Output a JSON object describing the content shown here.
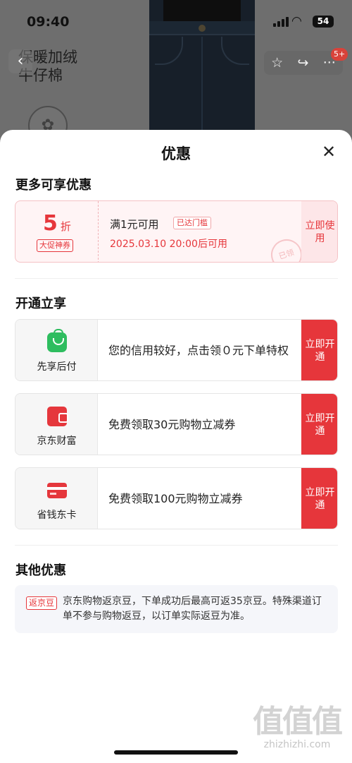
{
  "status_bar": {
    "time": "09:40",
    "battery": "54"
  },
  "background": {
    "promo_tag": "保暖加绒牛仔棉",
    "cart_count": "5+"
  },
  "sheet": {
    "title": "优惠",
    "more_title": "更多可享优惠",
    "coupon": {
      "discount_num": "5",
      "discount_unit": "折",
      "tag": "大促神券",
      "condition": "满1元可用",
      "reached": "已达门槛",
      "time": "2025.03.10 20:00后可用",
      "stamp": "已领",
      "use_button": "立即使用"
    },
    "open_title": "开通立享",
    "services": [
      {
        "icon": "shopping-bag-icon",
        "label": "先享后付",
        "desc": "您的信用较好，点击领０元下单特权",
        "button": "立即开通"
      },
      {
        "icon": "wallet-icon",
        "label": "京东财富",
        "desc": "免费领取30元购物立减券",
        "button": "立即开通"
      },
      {
        "icon": "card-icon",
        "label": "省钱东卡",
        "desc": "免费领取100元购物立减券",
        "button": "立即开通"
      }
    ],
    "other_title": "其他优惠",
    "bean": {
      "tag": "返京豆",
      "text": "京东购物返京豆，下单成功后最高可返35京豆。特殊渠道订单不参与购物返豆，以订单实际返豆为准。"
    }
  },
  "watermark": {
    "big": "值值值",
    "small": "zhizhizhi.com"
  },
  "colors": {
    "accent": "#e6363b",
    "green": "#2ebd5f"
  }
}
